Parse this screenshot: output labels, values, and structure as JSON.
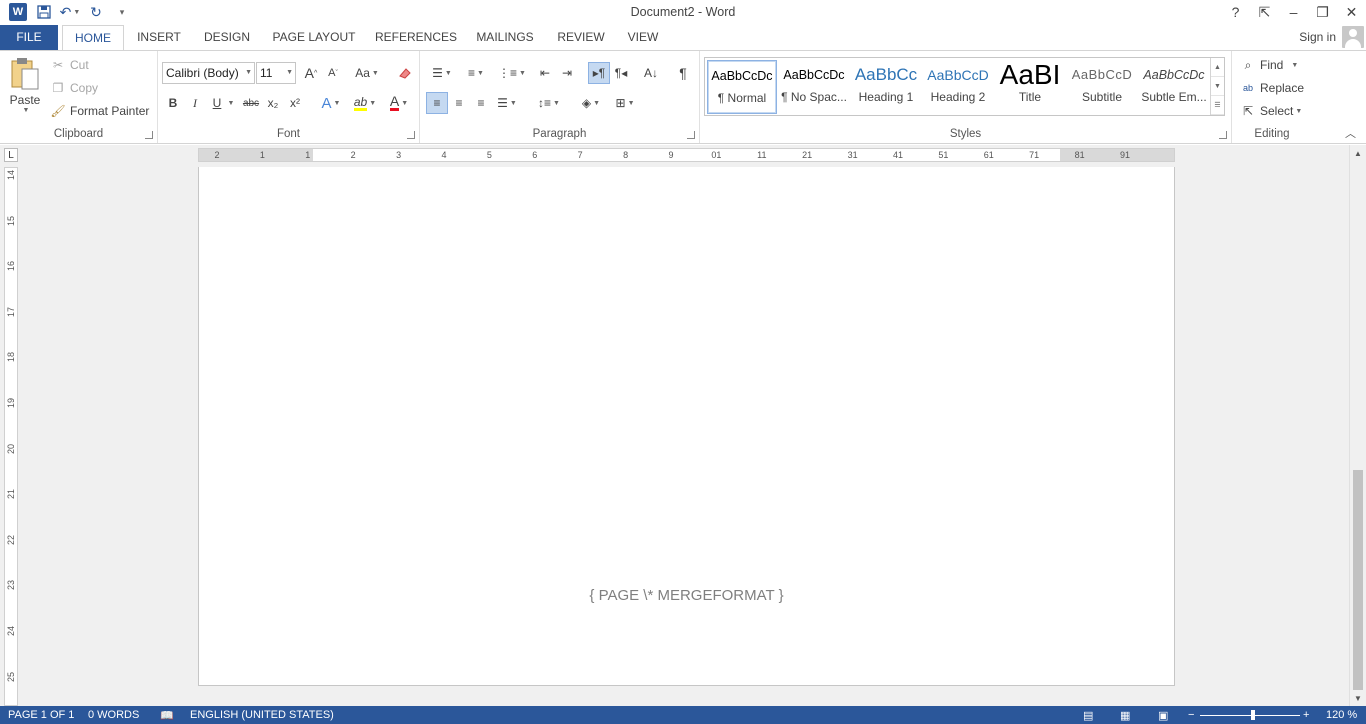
{
  "app": {
    "title": "Document2 - Word",
    "logo": "W"
  },
  "quick_access": {
    "icons": [
      "word-icon",
      "save-icon",
      "undo-icon",
      "redo-icon",
      "customize-icon"
    ]
  },
  "window_controls": {
    "help": "?",
    "restore_ribbon": "⇱",
    "minimize": "–",
    "maximize": "❐",
    "close": "✕"
  },
  "tabs": [
    {
      "label": "FILE"
    },
    {
      "label": "HOME"
    },
    {
      "label": "INSERT"
    },
    {
      "label": "DESIGN"
    },
    {
      "label": "PAGE LAYOUT"
    },
    {
      "label": "REFERENCES"
    },
    {
      "label": "MAILINGS"
    },
    {
      "label": "REVIEW"
    },
    {
      "label": "VIEW"
    }
  ],
  "signin": "Sign in",
  "clipboard": {
    "label": "Clipboard",
    "paste": "Paste",
    "cut": "Cut",
    "copy": "Copy",
    "format_painter": "Format Painter"
  },
  "font": {
    "label": "Font",
    "family": "Calibri (Body)",
    "size": "11",
    "grow": "A",
    "shrink": "A",
    "change_case": "Aa",
    "bold": "B",
    "italic": "I",
    "underline": "U",
    "strike": "abc",
    "subscript": "x₂",
    "superscript": "x²",
    "text_effects": "A",
    "highlight": "ab",
    "font_color": "A",
    "font_color_value": "#e81123",
    "highlight_value": "#ffff00"
  },
  "paragraph": {
    "label": "Paragraph",
    "show_marks": "¶"
  },
  "styles": {
    "label": "Styles",
    "items": [
      {
        "preview": "AaBbCcDc",
        "name": "¶ Normal"
      },
      {
        "preview": "AaBbCcDc",
        "name": "¶ No Spac..."
      },
      {
        "preview": "AaBbCc",
        "name": "Heading 1"
      },
      {
        "preview": "AaBbCcD",
        "name": "Heading 2"
      },
      {
        "preview": "AaBI",
        "name": "Title"
      },
      {
        "preview": "AaBbCcD",
        "name": "Subtitle"
      },
      {
        "preview": "AaBbCcDc",
        "name": "Subtle Em..."
      }
    ]
  },
  "editing": {
    "label": "Editing",
    "find": "Find",
    "replace": "Replace",
    "select": "Select"
  },
  "ruler": {
    "h_labels": [
      "2",
      "1",
      "1",
      "2",
      "3",
      "4",
      "5",
      "6",
      "7",
      "8",
      "9",
      "01",
      "11",
      "21",
      "31",
      "41",
      "51",
      "61",
      "71",
      "81",
      "91"
    ],
    "v_labels": [
      "14",
      "15",
      "16",
      "17",
      "18",
      "19",
      "20",
      "21",
      "22",
      "23",
      "24",
      "25"
    ],
    "corner": "L"
  },
  "document": {
    "field_code": "{ PAGE   \\* MERGEFORMAT }"
  },
  "statusbar": {
    "page": "PAGE 1 OF 1",
    "words": "0 WORDS",
    "language": "ENGLISH (UNITED STATES)",
    "zoom": "120 %",
    "zoom_level": 120
  },
  "colors": {
    "accent": "#2b579a"
  }
}
